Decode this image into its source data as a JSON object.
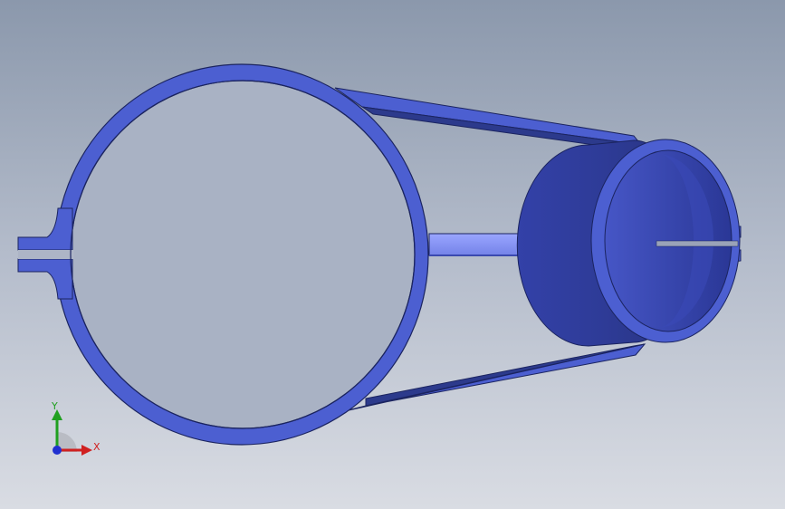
{
  "viewport": {
    "background_top": "#8b98ac",
    "background_bottom": "#d9dce3",
    "model_color": "#4c5fd1",
    "model_shadow": "#2c3a8c",
    "model_highlight": "#8a97f0"
  },
  "triad": {
    "x_label": "X",
    "y_label": "Y",
    "x_color": "#d02020",
    "y_color": "#20a020",
    "z_color": "#2030d0"
  }
}
